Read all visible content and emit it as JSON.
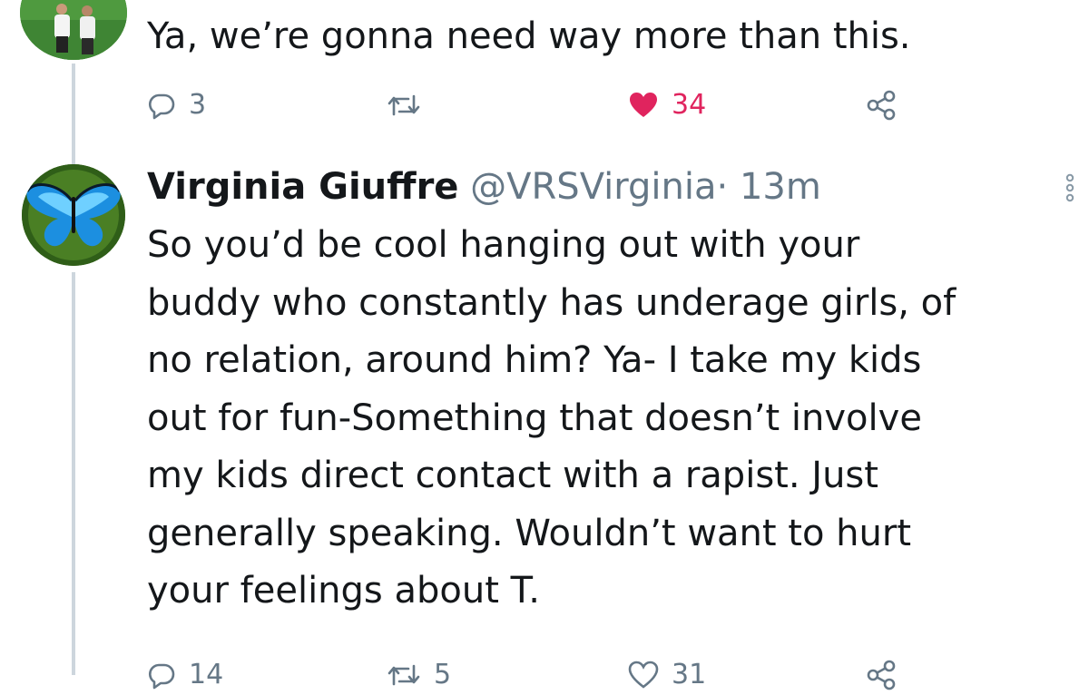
{
  "reply_tweet": {
    "text": "Ya, we’re gonna need way more than this.",
    "actions": {
      "reply_count": "3",
      "retweet_count": "",
      "like_count": "34",
      "colors": {
        "like": "#e0245e",
        "muted": "#657786"
      }
    }
  },
  "main_tweet": {
    "author_name": "Virginia Giuffre",
    "handle": "@VRSVirginia",
    "separator": "·",
    "time": "13m",
    "body_lines": [
      "So you’d be cool hanging out with your",
      "buddy who constantly has underage girls, of",
      "no relation, around him? Ya- I take my kids",
      "out for fun-Something that doesn’t involve",
      "my kids direct contact with a rapist. Just",
      "generally speaking. Wouldn’t want to hurt",
      "your feelings about T."
    ],
    "actions": {
      "reply_count": "14",
      "retweet_count": "5",
      "like_count": "31"
    }
  },
  "icons": [
    "reply-icon",
    "retweet-icon",
    "heart-icon",
    "share-icon",
    "more-options-icon"
  ]
}
